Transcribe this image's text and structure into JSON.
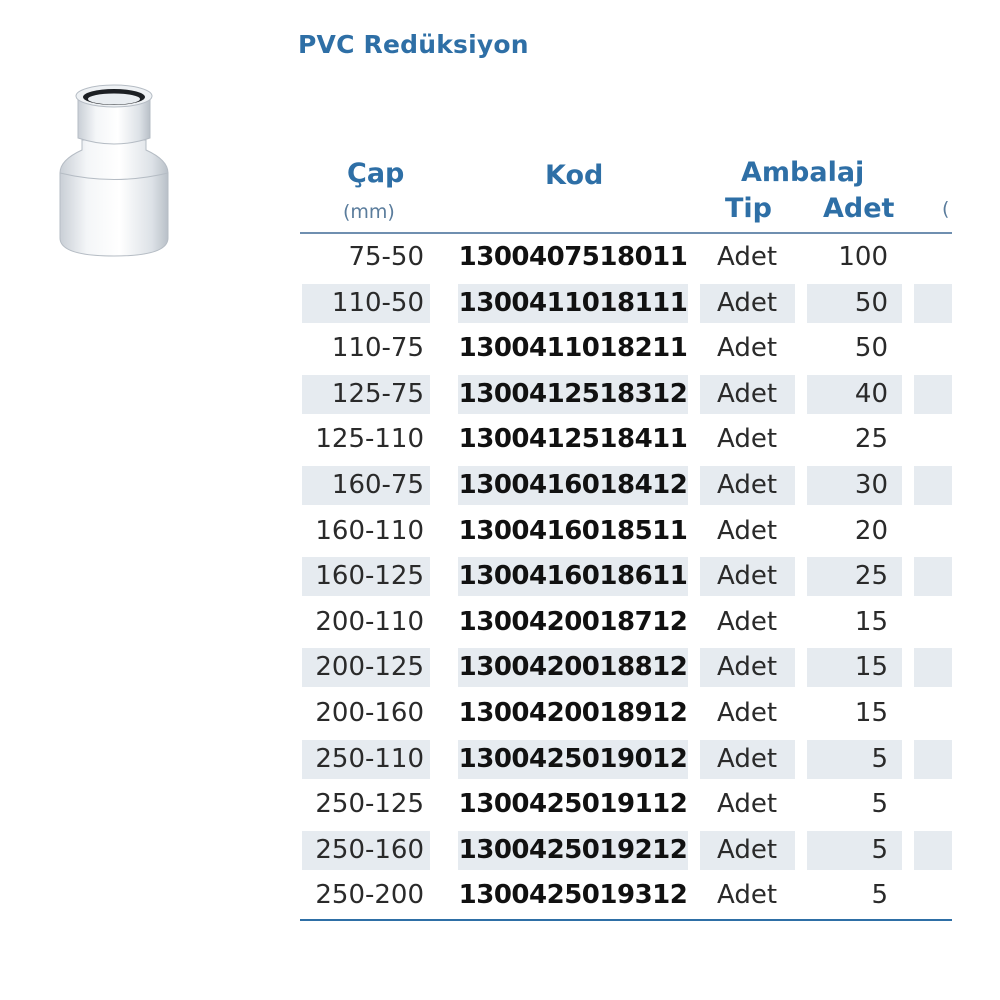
{
  "title": "PVC Redüksiyon",
  "headers": {
    "cap": "Çap",
    "cap_unit": "(mm)",
    "kod": "Kod",
    "ambalaj": "Ambalaj",
    "tip": "Tip",
    "adet": "Adet",
    "next_partial": "("
  },
  "rows": [
    {
      "cap": "75-50",
      "kod": "1300407518011",
      "tip": "Adet",
      "adet": "100"
    },
    {
      "cap": "110-50",
      "kod": "1300411018111",
      "tip": "Adet",
      "adet": "50"
    },
    {
      "cap": "110-75",
      "kod": "1300411018211",
      "tip": "Adet",
      "adet": "50"
    },
    {
      "cap": "125-75",
      "kod": "1300412518312",
      "tip": "Adet",
      "adet": "40"
    },
    {
      "cap": "125-110",
      "kod": "1300412518411",
      "tip": "Adet",
      "adet": "25"
    },
    {
      "cap": "160-75",
      "kod": "1300416018412",
      "tip": "Adet",
      "adet": "30"
    },
    {
      "cap": "160-110",
      "kod": "1300416018511",
      "tip": "Adet",
      "adet": "20"
    },
    {
      "cap": "160-125",
      "kod": "1300416018611",
      "tip": "Adet",
      "adet": "25"
    },
    {
      "cap": "200-110",
      "kod": "1300420018712",
      "tip": "Adet",
      "adet": "15"
    },
    {
      "cap": "200-125",
      "kod": "1300420018812",
      "tip": "Adet",
      "adet": "15"
    },
    {
      "cap": "200-160",
      "kod": "1300420018912",
      "tip": "Adet",
      "adet": "15"
    },
    {
      "cap": "250-110",
      "kod": "1300425019012",
      "tip": "Adet",
      "adet": "5"
    },
    {
      "cap": "250-125",
      "kod": "1300425019112",
      "tip": "Adet",
      "adet": "5"
    },
    {
      "cap": "250-160",
      "kod": "1300425019212",
      "tip": "Adet",
      "adet": "5"
    },
    {
      "cap": "250-200",
      "kod": "1300425019312",
      "tip": "Adet",
      "adet": "5"
    }
  ],
  "colors": {
    "accent": "#2e6fa6",
    "row_shade": "#e6ebf0",
    "text": "#2a2a2a"
  }
}
